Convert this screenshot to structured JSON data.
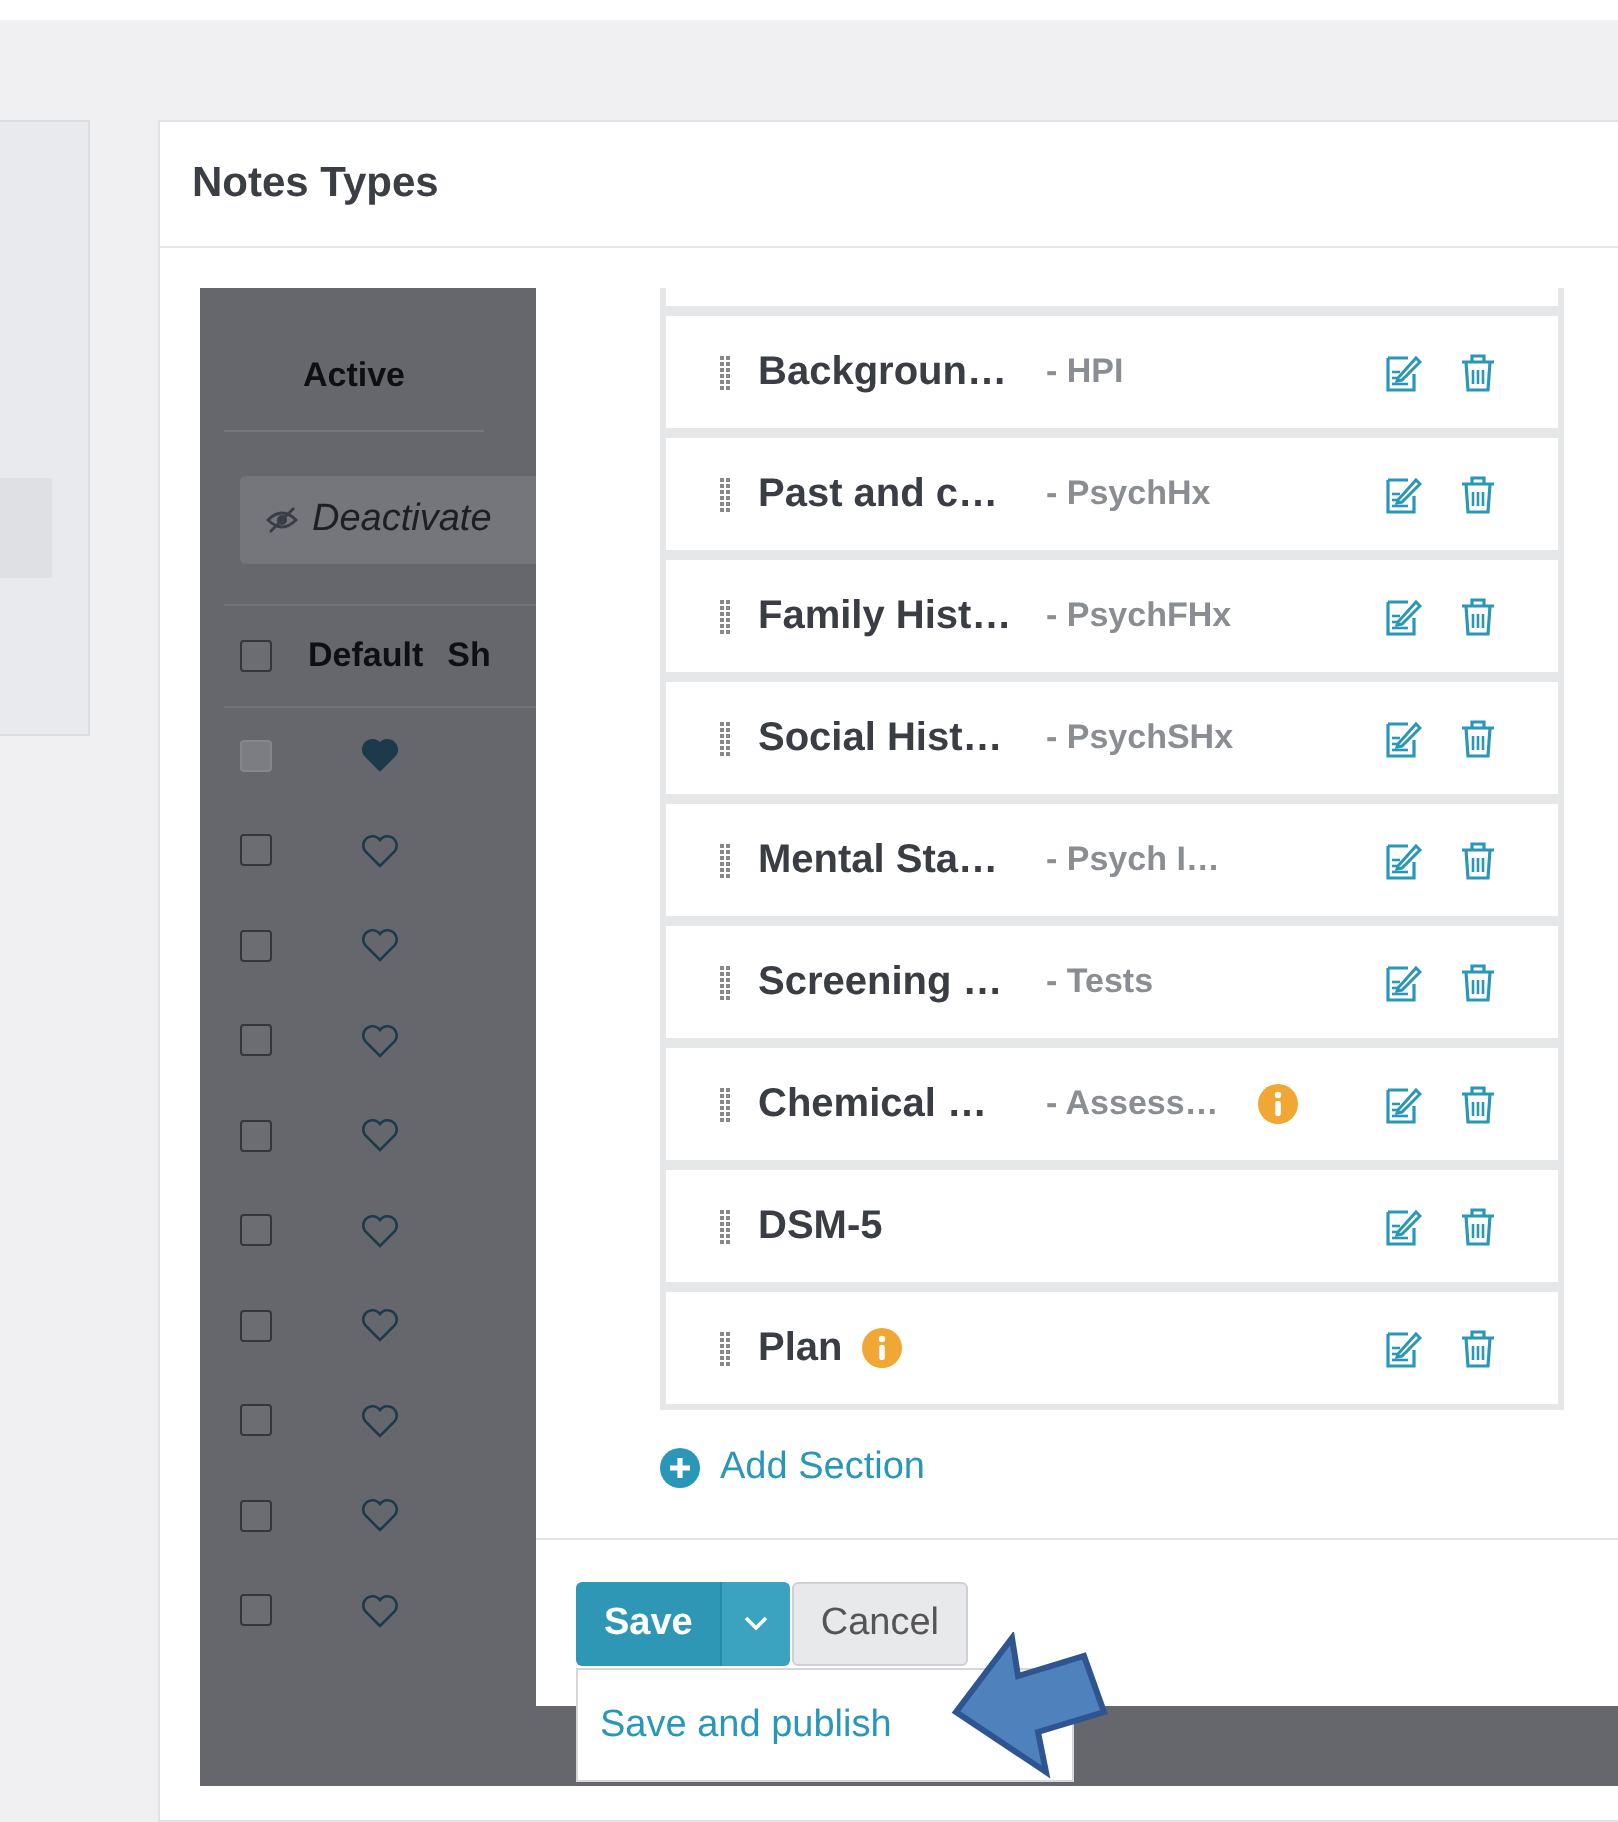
{
  "page": {
    "title": "Notes Types"
  },
  "background_table": {
    "tab": {
      "label": "Active",
      "selected": true
    },
    "deactivate_button": "Deactivate",
    "select_all": {
      "checked": false
    },
    "columns": [
      "Default",
      "Sh"
    ],
    "rows": [
      {
        "checked": false,
        "disabled": true,
        "default": true
      },
      {
        "checked": false,
        "disabled": false,
        "default": false
      },
      {
        "checked": false,
        "disabled": false,
        "default": false
      },
      {
        "checked": false,
        "disabled": false,
        "default": false
      },
      {
        "checked": false,
        "disabled": false,
        "default": false
      },
      {
        "checked": false,
        "disabled": false,
        "default": false
      },
      {
        "checked": false,
        "disabled": false,
        "default": false
      },
      {
        "checked": false,
        "disabled": false,
        "default": false
      },
      {
        "checked": false,
        "disabled": false,
        "default": false
      },
      {
        "checked": false,
        "disabled": false,
        "default": false
      }
    ]
  },
  "sections": [
    {
      "name": "Backgroun…",
      "abbreviation": "- HPI",
      "info": false
    },
    {
      "name": "Past and c…",
      "abbreviation": "- PsychHx",
      "info": false
    },
    {
      "name": "Family Hist…",
      "abbreviation": "- PsychFHx",
      "info": false
    },
    {
      "name": "Social Hist…",
      "abbreviation": "- PsychSHx",
      "info": false
    },
    {
      "name": "Mental Sta…",
      "abbreviation": "- Psych I…",
      "info": false
    },
    {
      "name": "Screening …",
      "abbreviation": "- Tests",
      "info": false
    },
    {
      "name": "Chemical …",
      "abbreviation": "- Assess…",
      "info": true
    },
    {
      "name": "DSM-5",
      "info": false
    },
    {
      "name": "Plan",
      "info": true
    }
  ],
  "add_section": "Add Section",
  "footer": {
    "save": "Save",
    "cancel": "Cancel",
    "menu": [
      "Save and publish"
    ]
  }
}
